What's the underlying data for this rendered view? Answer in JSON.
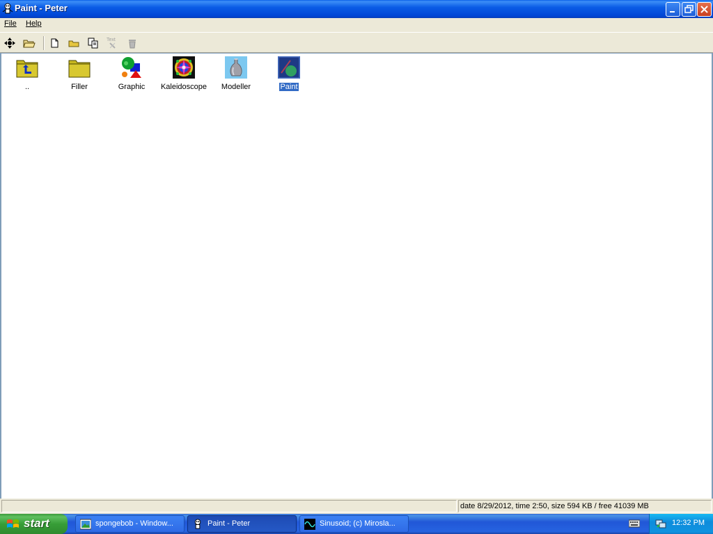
{
  "window": {
    "title": "Paint - Peter"
  },
  "menu": {
    "items": [
      {
        "label": "File"
      },
      {
        "label": "Help"
      }
    ]
  },
  "toolbar": {
    "buttons": [
      {
        "icon": "navigate-icon"
      },
      {
        "icon": "open-folder-icon"
      },
      {
        "icon": "new-file-icon"
      },
      {
        "icon": "new-folder-icon"
      },
      {
        "icon": "copy-icon"
      },
      {
        "icon": "text-icon",
        "label": "Text",
        "disabled": true
      },
      {
        "icon": "trash-icon",
        "disabled": true
      }
    ]
  },
  "files": [
    {
      "label": "..",
      "icon": "parent-folder-icon"
    },
    {
      "label": "Filler",
      "icon": "folder-icon"
    },
    {
      "label": "Graphic",
      "icon": "shapes-icon"
    },
    {
      "label": "Kaleidoscope",
      "icon": "kaleidoscope-icon"
    },
    {
      "label": "Modeller",
      "icon": "vase-icon"
    },
    {
      "label": "Paint",
      "icon": "paint-icon",
      "selected": true
    }
  ],
  "status": {
    "left": "",
    "right": "date 8/29/2012, time 2:50, size 594 KB / free 41039 MB"
  },
  "taskbar": {
    "start_label": "start",
    "tasks": [
      {
        "label": "spongebob - Window...",
        "icon": "image-viewer-icon"
      },
      {
        "label": "Paint - Peter",
        "icon": "peter-app-icon",
        "active": true
      },
      {
        "label": "Sinusoid;   (c) Mirosla...",
        "icon": "sinusoid-icon"
      }
    ],
    "clock": "12:32 PM"
  },
  "colors": {
    "titlebar": "#0054E3",
    "selection": "#316AC5",
    "taskbar": "#245EDB",
    "start": "#3C9A3C"
  }
}
